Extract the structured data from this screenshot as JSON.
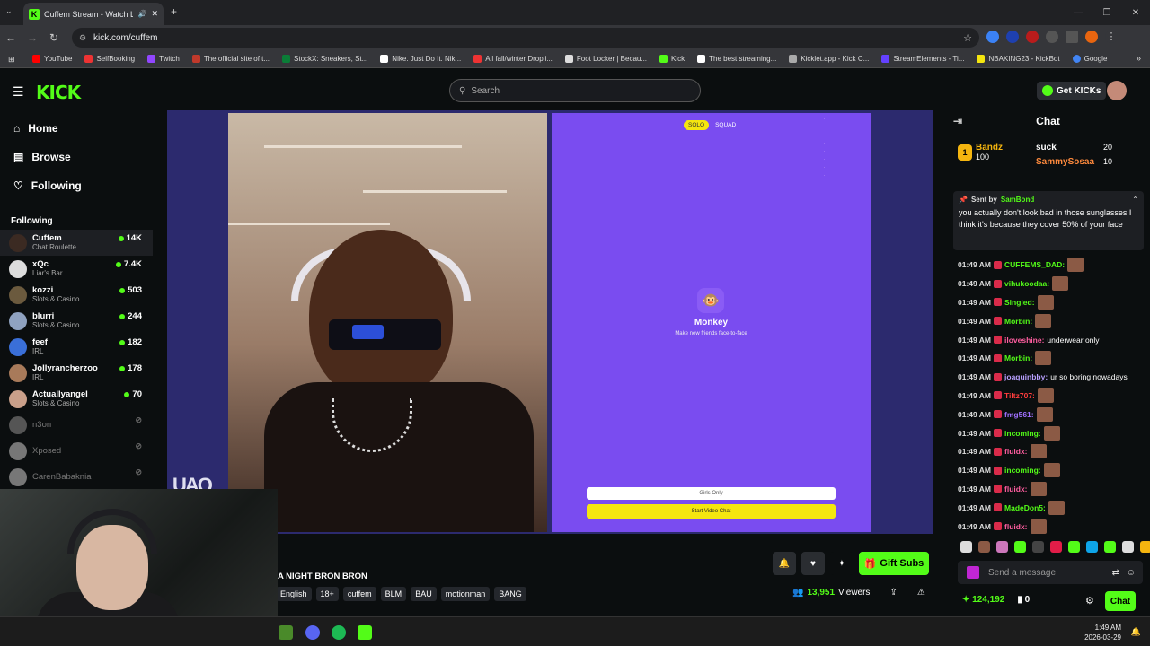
{
  "browser": {
    "tab_title": "Cuffem Stream - Watch Live",
    "url": "kick.com/cuffem",
    "bookmarks": [
      {
        "label": "YouTube",
        "color": "#ff0000"
      },
      {
        "label": "SelfBooking",
        "color": "#e33"
      },
      {
        "label": "Twitch",
        "color": "#9146ff"
      },
      {
        "label": "The official site of t...",
        "color": "#c0392b"
      },
      {
        "label": "StockX: Sneakers, St...",
        "color": "#0a7d37"
      },
      {
        "label": "Nike. Just Do It. Nik...",
        "color": "#fff"
      },
      {
        "label": "All fall/winter Dropli...",
        "color": "#e33"
      },
      {
        "label": "Foot Locker | Becau...",
        "color": "#ddd"
      },
      {
        "label": "Kick",
        "color": "#53fc18"
      },
      {
        "label": "The best streaming...",
        "color": "#fff"
      },
      {
        "label": "Kicklet.app - Kick C...",
        "color": "#aaa"
      },
      {
        "label": "StreamElements - Ti...",
        "color": "#6441ff"
      },
      {
        "label": "NBAKING23 - KickBot",
        "color": "#f5e60f"
      },
      {
        "label": "Google",
        "color": "#4285f4"
      }
    ]
  },
  "header": {
    "logo": "KICK",
    "search_placeholder": "Search",
    "get_kicks": "Get KICKs"
  },
  "sidebar": {
    "nav": [
      {
        "label": "Home",
        "icon": "home-icon",
        "glyph": "⌂"
      },
      {
        "label": "Browse",
        "icon": "browse-icon",
        "glyph": "▤"
      },
      {
        "label": "Following",
        "icon": "heart-icon",
        "glyph": "♡"
      }
    ],
    "section_label": "Following",
    "channels": [
      {
        "name": "Cuffem",
        "category": "Chat Roulette",
        "viewers": "14K",
        "live": true,
        "color": "#3b2a22"
      },
      {
        "name": "xQc",
        "category": "Liar's Bar",
        "viewers": "7.4K",
        "live": true,
        "color": "#ddd"
      },
      {
        "name": "kozzi",
        "category": "Slots & Casino",
        "viewers": "503",
        "live": true,
        "color": "#6b5a3e"
      },
      {
        "name": "blurri",
        "category": "Slots & Casino",
        "viewers": "244",
        "live": true,
        "color": "#8fa2c0"
      },
      {
        "name": "feef",
        "category": "IRL",
        "viewers": "182",
        "live": true,
        "color": "#3a6fd8"
      },
      {
        "name": "Jollyrancherzoo",
        "category": "IRL",
        "viewers": "178",
        "live": true,
        "color": "#a87a5a"
      },
      {
        "name": "Actuallyangel",
        "category": "Slots & Casino",
        "viewers": "70",
        "live": true,
        "color": "#caa08a"
      },
      {
        "name": "n3on",
        "category": "",
        "viewers": "",
        "live": false,
        "color": "#555"
      },
      {
        "name": "Xposed",
        "category": "",
        "viewers": "",
        "live": false,
        "color": "#777"
      },
      {
        "name": "CarenBabaknia",
        "category": "",
        "viewers": "",
        "live": false,
        "color": "#777"
      }
    ]
  },
  "stream": {
    "overlay_watermark": "UAQ",
    "monkey": {
      "tabs": [
        "SOLO",
        "SQUAD"
      ],
      "title": "Monkey",
      "subtitle": "Make new friends face-to-face",
      "girls_only": "Girls Only",
      "start": "Start Video Chat"
    },
    "title": "A NIGHT BRON BRON",
    "tags": [
      "English",
      "18+",
      "cuffem",
      "BLM",
      "BAU",
      "motionman",
      "BANG"
    ],
    "viewers": "13,951",
    "viewers_label": "Viewers",
    "gift_subs": "Gift Subs"
  },
  "chat": {
    "title": "Chat",
    "leaderboard": [
      {
        "rank": "1",
        "name": "Bandz",
        "value": "100"
      },
      {
        "name": "suck",
        "value": "20"
      },
      {
        "name": "SammySosaa",
        "value": "10"
      }
    ],
    "pinned": {
      "sent_by": "Sent by",
      "user": "SamBond",
      "message": "you actually don't look bad in those sunglasses I think it's because they cover 50% of your face"
    },
    "messages": [
      {
        "time": "01:49 AM",
        "user": "CUFFEMS_DAD:",
        "color": "#53fc18",
        "text": "",
        "emote": true
      },
      {
        "time": "01:49 AM",
        "user": "vihukoodaa:",
        "color": "#53fc18",
        "text": "",
        "emote": true
      },
      {
        "time": "01:49 AM",
        "user": "Singled:",
        "color": "#53fc18",
        "text": "",
        "emote": true
      },
      {
        "time": "01:49 AM",
        "user": "Morbin:",
        "color": "#53fc18",
        "text": "",
        "emote": true
      },
      {
        "time": "01:49 AM",
        "user": "iloveshine:",
        "color": "#ff5ea0",
        "text": "underwear only",
        "emote": false
      },
      {
        "time": "01:49 AM",
        "user": "Morbin:",
        "color": "#53fc18",
        "text": "",
        "emote": true
      },
      {
        "time": "01:49 AM",
        "user": "joaquinbby:",
        "color": "#b8a0ff",
        "text": "ur so boring nowadays",
        "emote": false
      },
      {
        "time": "01:49 AM",
        "user": "Tiltz707:",
        "color": "#ff3d3d",
        "text": "",
        "emote": true
      },
      {
        "time": "01:49 AM",
        "user": "fmg561:",
        "color": "#a070ff",
        "text": "",
        "emote": true
      },
      {
        "time": "01:49 AM",
        "user": "incoming:",
        "color": "#53fc18",
        "text": "",
        "emote": true
      },
      {
        "time": "01:49 AM",
        "user": "fluidx:",
        "color": "#ff5ea0",
        "text": "",
        "emote": true
      },
      {
        "time": "01:49 AM",
        "user": "incoming:",
        "color": "#53fc18",
        "text": "",
        "emote": true
      },
      {
        "time": "01:49 AM",
        "user": "fluidx:",
        "color": "#ff5ea0",
        "text": "",
        "emote": true
      },
      {
        "time": "01:49 AM",
        "user": "MadeDon5:",
        "color": "#53fc18",
        "text": "",
        "emote": true
      },
      {
        "time": "01:49 AM",
        "user": "fluidx:",
        "color": "#ff5ea0",
        "text": "",
        "emote": true
      }
    ],
    "send_placeholder": "Send a message",
    "points": "124,192",
    "count": "0",
    "chat_button": "Chat"
  },
  "taskbar": {
    "time": "1:49 AM",
    "date": "2026-03-29"
  }
}
